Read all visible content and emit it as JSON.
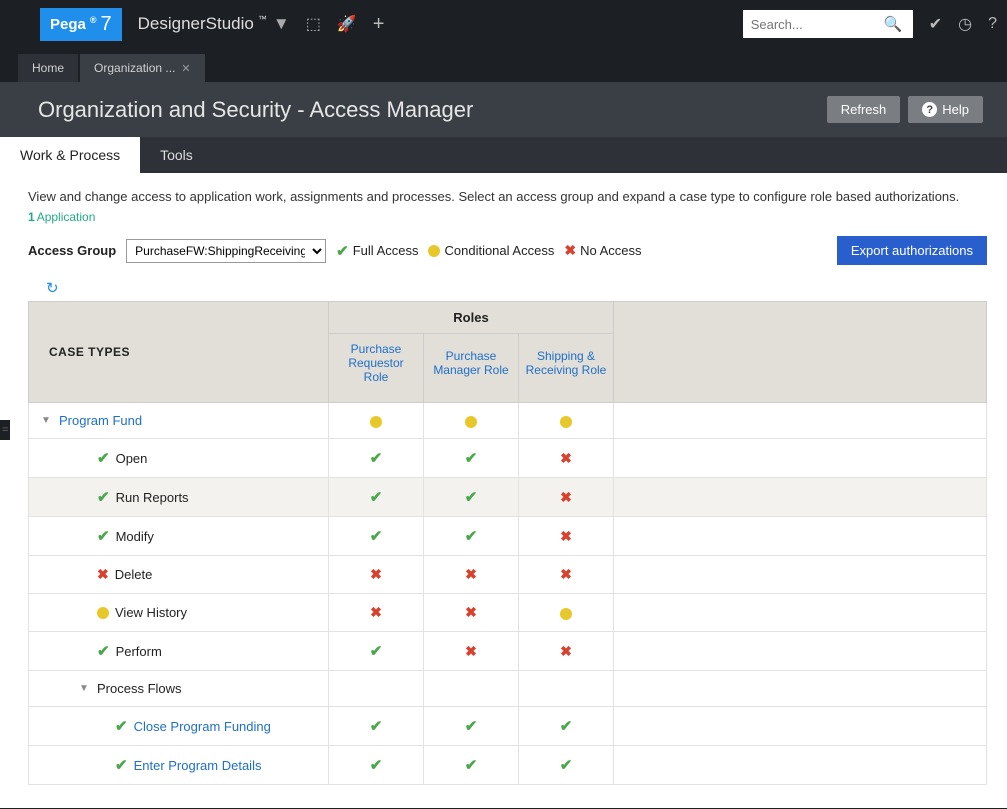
{
  "header": {
    "logo_text": "Pega",
    "logo_reg": "®",
    "logo_num": "7",
    "brand": "DesignerStudio",
    "brand_tm": "™",
    "search_placeholder": "Search..."
  },
  "doc_tabs": [
    {
      "label": "Home",
      "closable": false
    },
    {
      "label": "Organization ...",
      "closable": true
    }
  ],
  "title": "Organization and Security - Access Manager",
  "buttons": {
    "refresh": "Refresh",
    "help": "Help"
  },
  "subtabs": [
    {
      "label": "Work & Process",
      "active": true
    },
    {
      "label": "Tools",
      "active": false
    }
  ],
  "intro": "View and change access to application work, assignments and processes. Select an access group and expand a case type to configure role based authorizations.",
  "app_count": "1",
  "app_link": "Application",
  "access_group_label": "Access Group",
  "access_group_value": "PurchaseFW:ShippingReceiving",
  "legend": {
    "full": "Full Access",
    "conditional": "Conditional Access",
    "none": "No Access"
  },
  "export_label": "Export authorizations",
  "table": {
    "case_types_header": "CASE TYPES",
    "roles_header": "Roles",
    "role_columns": [
      "Purchase Requestor Role",
      "Purchase Manager Role",
      "Shipping & Receiving Role"
    ],
    "rows": [
      {
        "name": "Program Fund",
        "indent": 0,
        "link": true,
        "caret": true,
        "icon": "",
        "cells": [
          "cond",
          "cond",
          "cond"
        ]
      },
      {
        "name": "Open",
        "indent": 1,
        "icon": "full",
        "cells": [
          "full",
          "full",
          "none"
        ]
      },
      {
        "name": "Run Reports",
        "indent": 1,
        "icon": "full",
        "cells": [
          "full",
          "full",
          "none"
        ],
        "alt": true
      },
      {
        "name": "Modify",
        "indent": 1,
        "icon": "full",
        "cells": [
          "full",
          "full",
          "none"
        ]
      },
      {
        "name": "Delete",
        "indent": 1,
        "icon": "none",
        "cells": [
          "none",
          "none",
          "none"
        ]
      },
      {
        "name": "View History",
        "indent": 1,
        "icon": "cond",
        "cells": [
          "none",
          "none",
          "cond"
        ]
      },
      {
        "name": "Perform",
        "indent": 1,
        "icon": "full",
        "cells": [
          "full",
          "none",
          "none"
        ]
      },
      {
        "name": "Process Flows",
        "indent": 1,
        "caret": true,
        "icon": "",
        "cells": [
          "",
          "",
          ""
        ]
      },
      {
        "name": "Close Program Funding",
        "indent": 2,
        "link": true,
        "icon": "full",
        "cells": [
          "full",
          "full",
          "full"
        ]
      },
      {
        "name": "Enter Program Details",
        "indent": 2,
        "link": true,
        "icon": "full",
        "cells": [
          "full",
          "full",
          "full"
        ]
      }
    ]
  }
}
